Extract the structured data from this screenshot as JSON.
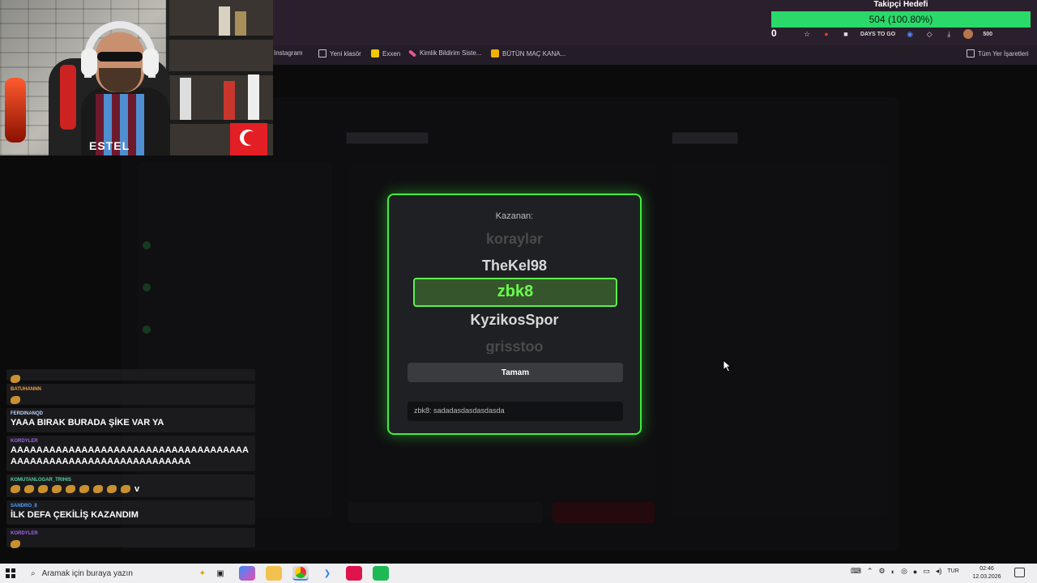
{
  "follower_goal": {
    "title": "Takipçi Hedefi",
    "progress_text": "504 (100.80%)",
    "progress_fraction": 1.0,
    "current_count": "0",
    "color": "#2bd96a"
  },
  "browser": {
    "bookmarks": [
      {
        "label": "Instagram",
        "icon": "instagram-icon"
      },
      {
        "label": "Yeni klasör",
        "icon": "folder-icon"
      },
      {
        "label": "Exxen",
        "icon": "exxen-icon"
      },
      {
        "label": "Kimlik Bildirim Siste...",
        "icon": "pen-icon"
      },
      {
        "label": "BÜTÜN MAÇ KANA...",
        "icon": "jp-icon"
      }
    ],
    "all_bookmarks_label": "Tüm Yer İşaretleri",
    "toolbar": {
      "days_label": "DAYS TO GO",
      "badge": "500"
    }
  },
  "modal": {
    "title": "Kazanan:",
    "reel": [
      "koraylər",
      "TheKel98",
      "zbk8",
      "KyzikosSpor",
      "grisstoo"
    ],
    "winner": "zbk8",
    "ok_button": "Tamam",
    "winner_message": "zbk8: sadadasdasdasdasda",
    "accent": "#3df03a"
  },
  "chat": {
    "messages": [
      {
        "user": "",
        "text": "",
        "emote": true,
        "user_color": "#9b5fd6"
      },
      {
        "user": "BATUHANNN",
        "text": "",
        "emote": true,
        "user_color": "#f0a050"
      },
      {
        "user": "FERDINANQD",
        "text": "YAAA BIRAK BURADA ŞİKE VAR YA",
        "emote": false,
        "user_color": "#bcd4ff"
      },
      {
        "user": "KORDYLER",
        "text": "AAAAAAAAAAAAAAAAAAAAAAAAAAAAAAAAAAAAAAAAAAAAAAAAAAAAAAAAAAAAAAAAA",
        "emote": false,
        "user_color": "#a065e8"
      },
      {
        "user": "KOMUTANLOGAR_TRIHIS",
        "text": "v",
        "emote_count": 9,
        "user_color": "#57d1a0"
      },
      {
        "user": "SANDRO_8",
        "text": "İLK DEFA ÇEKİLİŞ KAZANDIM",
        "emote": false,
        "user_color": "#4fa3ff"
      },
      {
        "user": "KORDYLER",
        "text": "",
        "emote": true,
        "user_color": "#a065e8"
      }
    ]
  },
  "taskbar": {
    "search_placeholder": "Aramak için buraya yazın",
    "language": "TUR",
    "time": "02:46",
    "date": "12.03.2026"
  },
  "webcam": {
    "shirt_text": "ESTEL"
  }
}
